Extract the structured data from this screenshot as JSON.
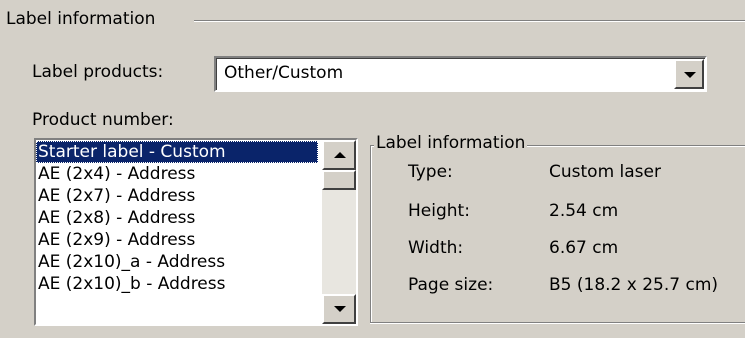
{
  "outer_group": {
    "title": "Label information"
  },
  "label_products": {
    "label": "Label products:",
    "value": "Other/Custom"
  },
  "product_number": {
    "label": "Product number:",
    "items": [
      "Starter label - Custom",
      "AE (2x4) - Address",
      "AE (2x7) - Address",
      "AE (2x8) - Address",
      "AE (2x9) - Address",
      "AE (2x10)_a - Address",
      "AE (2x10)_b - Address"
    ],
    "selected_index": 0
  },
  "info_group": {
    "title": "Label information",
    "rows": [
      {
        "key": "Type:",
        "value": "Custom laser"
      },
      {
        "key": "Height:",
        "value": "2.54 cm"
      },
      {
        "key": "Width:",
        "value": "6.67 cm"
      },
      {
        "key": "Page size:",
        "value": "B5 (18.2 x 25.7 cm)"
      }
    ]
  },
  "colors": {
    "face": "#d4d0c8",
    "selection": "#0a246a",
    "shadow": "#808080"
  },
  "icons": {
    "combo_dropdown": "chevron-down-icon",
    "scroll_up": "scroll-up-arrow-icon",
    "scroll_down": "scroll-down-arrow-icon"
  }
}
